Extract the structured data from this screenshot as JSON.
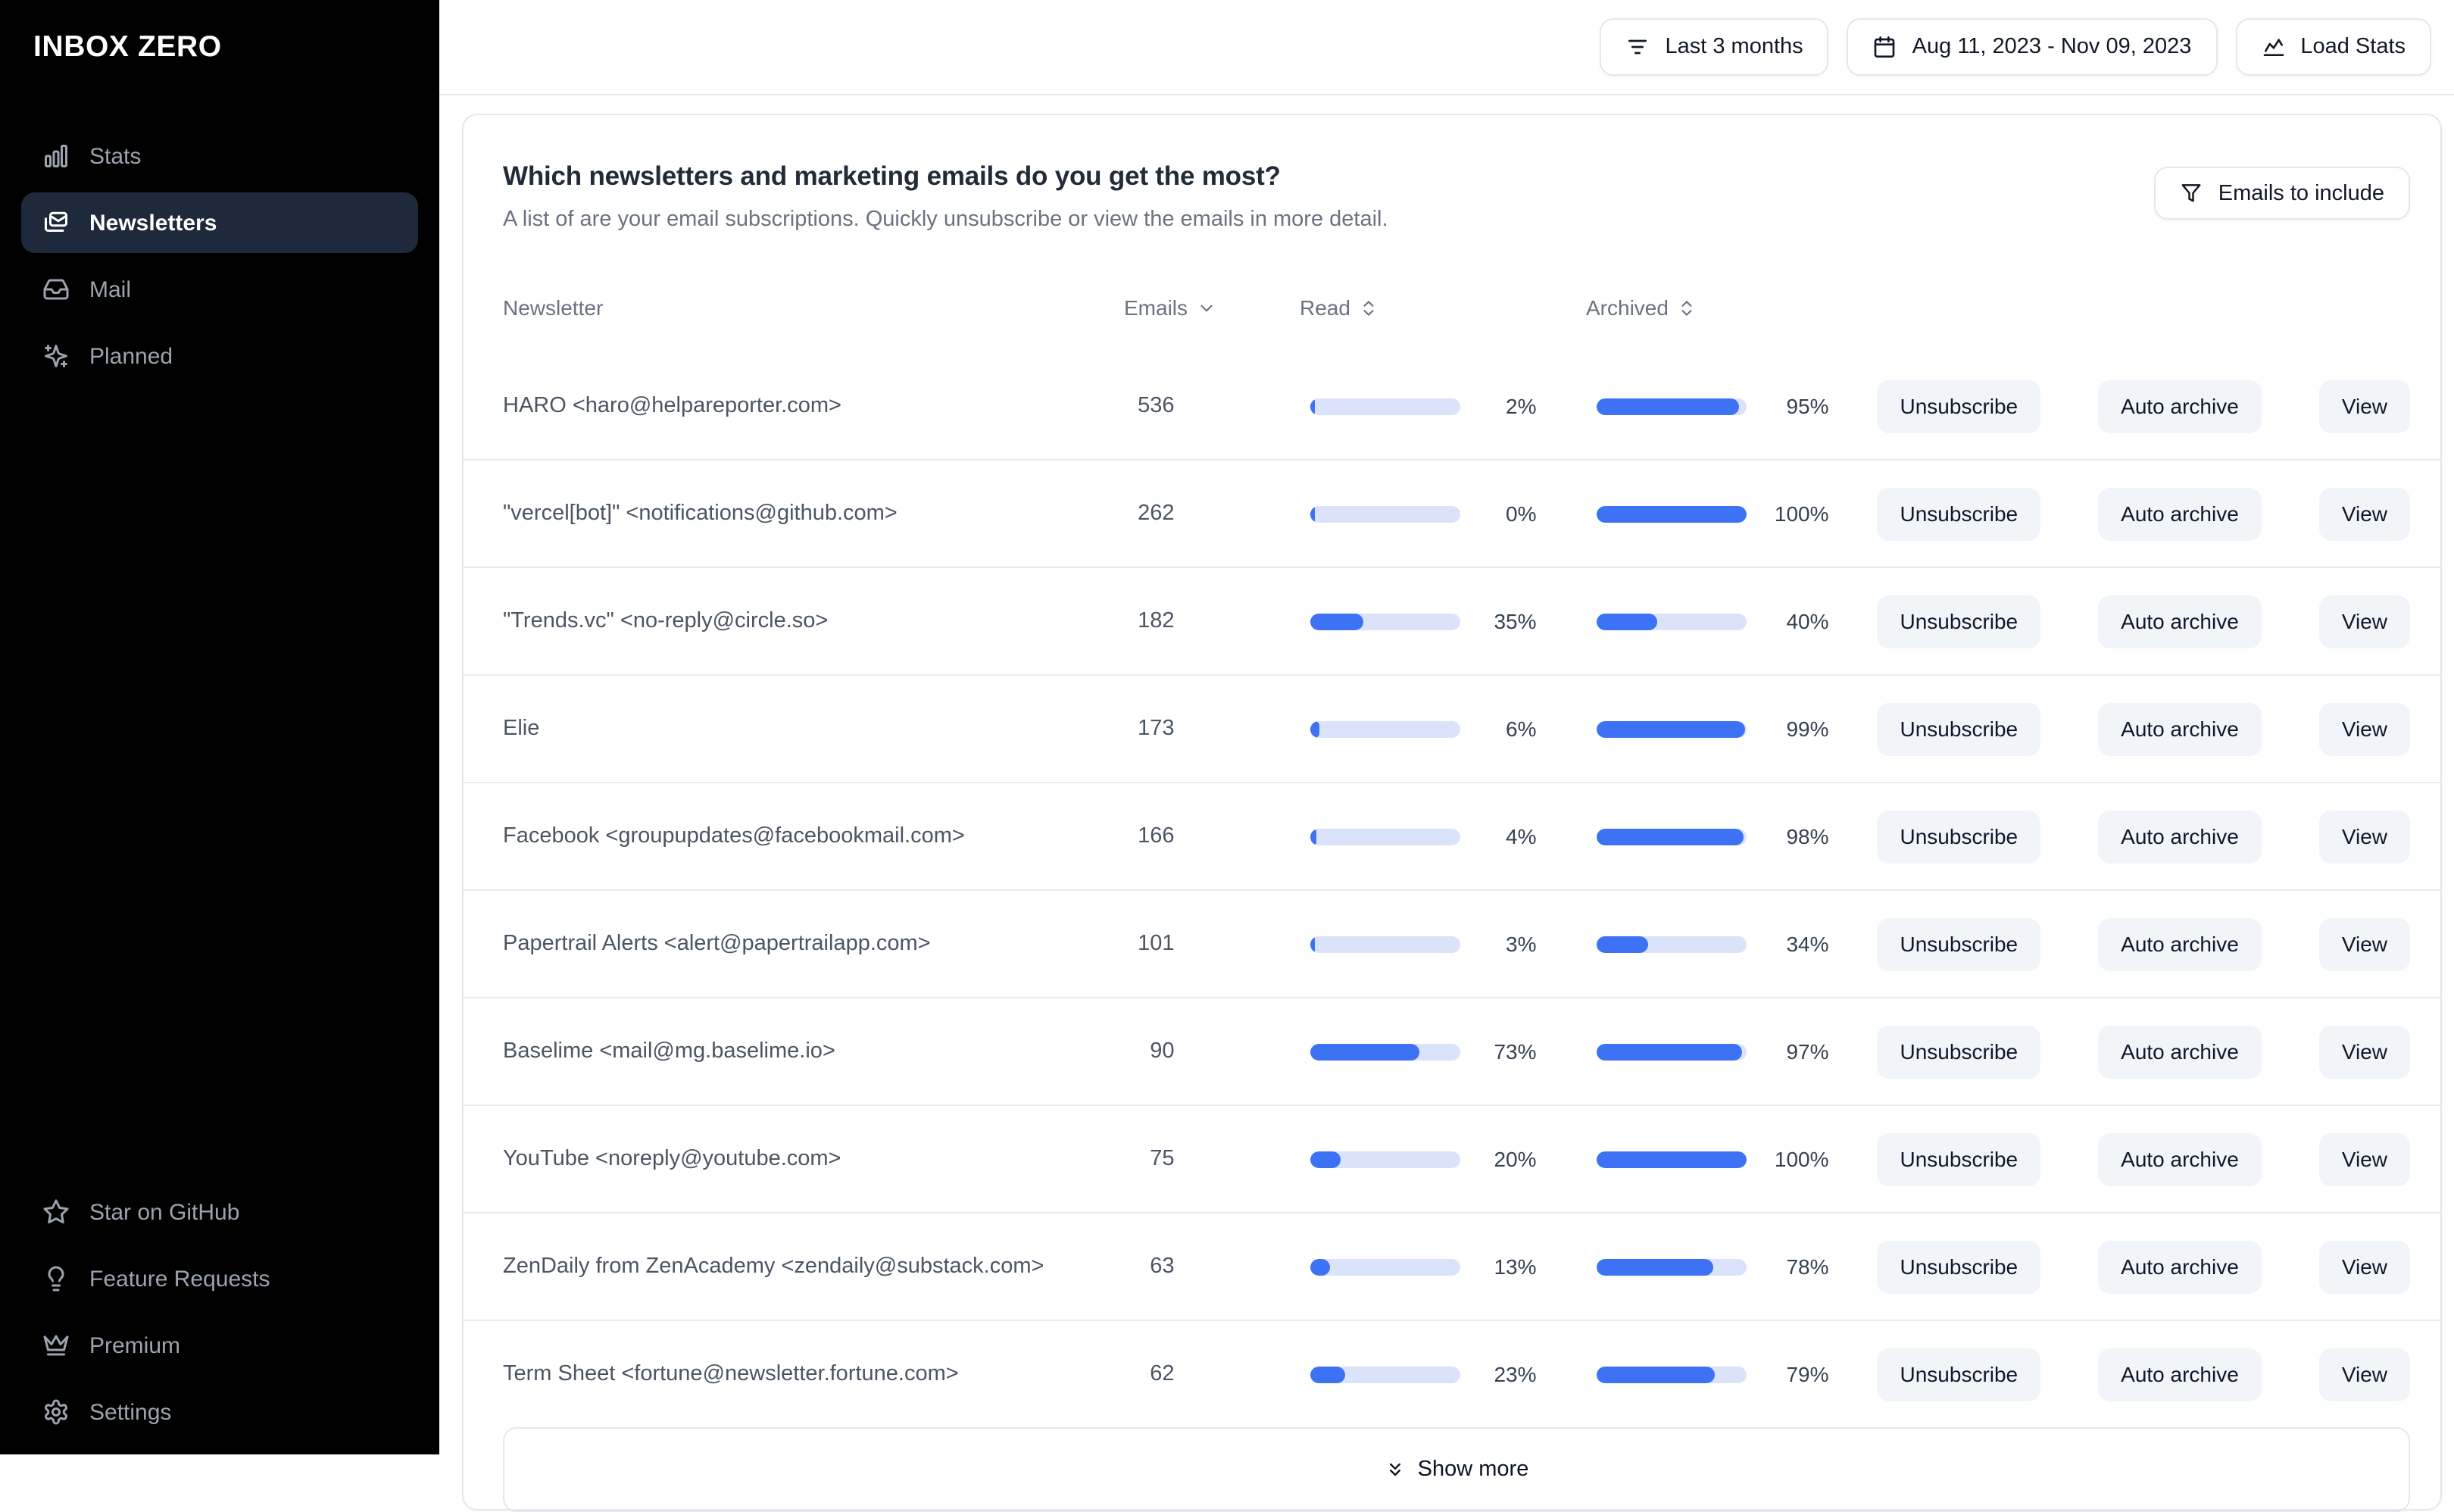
{
  "app": {
    "logo": "INBOX ZERO"
  },
  "sidebar": {
    "items": [
      {
        "label": "Stats",
        "icon": "bar-chart",
        "active": false
      },
      {
        "label": "Newsletters",
        "icon": "mails",
        "active": true
      },
      {
        "label": "Mail",
        "icon": "inbox",
        "active": false
      },
      {
        "label": "Planned",
        "icon": "sparkles",
        "active": false
      }
    ],
    "footer_items": [
      {
        "label": "Star on GitHub",
        "icon": "star"
      },
      {
        "label": "Feature Requests",
        "icon": "lightbulb"
      },
      {
        "label": "Premium",
        "icon": "crown"
      },
      {
        "label": "Settings",
        "icon": "gear"
      }
    ]
  },
  "topbar": {
    "buttons": [
      {
        "label": "Last 3 months",
        "icon": "filter-lines"
      },
      {
        "label": "Aug 11, 2023 - Nov 09, 2023",
        "icon": "calendar"
      },
      {
        "label": "Load Stats",
        "icon": "chart-line"
      }
    ]
  },
  "main": {
    "title": "Which newsletters and marketing emails do you get the most?",
    "subtitle": "A list of are your email subscriptions. Quickly unsubscribe or view the emails in more detail.",
    "filter_button": {
      "label": "Emails to include",
      "icon": "funnel"
    },
    "table": {
      "columns": [
        {
          "label": "Newsletter",
          "sort_icon": ""
        },
        {
          "label": "Emails",
          "sort_icon": "chevron-down"
        },
        {
          "label": "Read",
          "sort_icon": "chevrons-up-down"
        },
        {
          "label": "Archived",
          "sort_icon": "chevrons-up-down"
        }
      ],
      "action_labels": [
        "Unsubscribe",
        "Auto archive",
        "View"
      ],
      "rows": [
        {
          "name": "HARO <haro@helpareporter.com>",
          "emails": 536,
          "read_pct": 2,
          "archived_pct": 95
        },
        {
          "name": "\"vercel[bot]\" <notifications@github.com>",
          "emails": 262,
          "read_pct": 0,
          "archived_pct": 100
        },
        {
          "name": "\"Trends.vc\" <no-reply@circle.so>",
          "emails": 182,
          "read_pct": 35,
          "archived_pct": 40
        },
        {
          "name": "Elie",
          "emails": 173,
          "read_pct": 6,
          "archived_pct": 99
        },
        {
          "name": "Facebook <groupupdates@facebookmail.com>",
          "emails": 166,
          "read_pct": 4,
          "archived_pct": 98
        },
        {
          "name": "Papertrail Alerts <alert@papertrailapp.com>",
          "emails": 101,
          "read_pct": 3,
          "archived_pct": 34
        },
        {
          "name": "Baselime <mail@mg.baselime.io>",
          "emails": 90,
          "read_pct": 73,
          "archived_pct": 97
        },
        {
          "name": "YouTube <noreply@youtube.com>",
          "emails": 75,
          "read_pct": 20,
          "archived_pct": 100
        },
        {
          "name": "ZenDaily from ZenAcademy <zendaily@substack.com>",
          "emails": 63,
          "read_pct": 13,
          "archived_pct": 78
        },
        {
          "name": "Term Sheet <fortune@newsletter.fortune.com>",
          "emails": 62,
          "read_pct": 23,
          "archived_pct": 79
        }
      ],
      "show_more": {
        "label": "Show more",
        "icon": "chevrons-down"
      }
    }
  },
  "colors": {
    "accent": "#3d72f4",
    "bar_track": "#dbe3fb",
    "sidebar_active_bg": "#1e293b"
  }
}
